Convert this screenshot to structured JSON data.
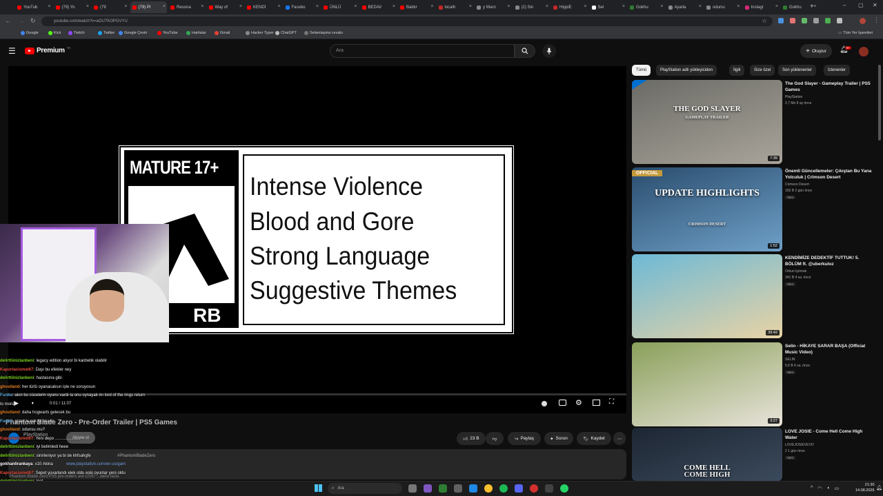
{
  "browser": {
    "tabs": [
      {
        "label": "YouTub",
        "color": "#ff0000"
      },
      {
        "label": "(79) Yo",
        "color": "#ff0000"
      },
      {
        "label": "(79",
        "color": "#ff0000"
      },
      {
        "label": "(79) Pl",
        "color": "#ff0000"
      },
      {
        "label": "Resona",
        "color": "#ff0000"
      },
      {
        "label": "Way of",
        "color": "#ff0000"
      },
      {
        "label": "KENDİ",
        "color": "#ff0000"
      },
      {
        "label": "Facebo",
        "color": "#1877f2"
      },
      {
        "label": "ÜNLÜ",
        "color": "#ff0000"
      },
      {
        "label": "BEDAV",
        "color": "#ff0000"
      },
      {
        "label": "Baldır",
        "color": "#ff0000"
      },
      {
        "label": "localh",
        "color": "#c62828"
      },
      {
        "label": "y Warn",
        "color": "#888888"
      },
      {
        "label": "(2) Sin",
        "color": "#888888"
      },
      {
        "label": "HippiE",
        "color": "#c62828"
      },
      {
        "label": "Sel",
        "color": "#ffffff"
      },
      {
        "label": "Gokhu",
        "color": "#2e7d32"
      },
      {
        "label": "Ayarla",
        "color": "#888888"
      },
      {
        "label": "odunsı",
        "color": "#888888"
      },
      {
        "label": "Instagr",
        "color": "#d62976"
      },
      {
        "label": "Gokhu",
        "color": "#2e7d32"
      }
    ],
    "url": "youtube.com/watch?v=aOU7KOPGVYU",
    "bookmarks": [
      "Google",
      "Kick",
      "Twitch",
      "Twitter",
      "Google Çeviri",
      "YouTube",
      "Haritalar",
      "Gmail",
      "Hacker Typer",
      "ChatGPT",
      "Selamlaşma cevabı"
    ],
    "bookmarks_right": "Tüm Yer İşaretleri"
  },
  "youtube": {
    "logo": "Premium",
    "logo_region": "TR",
    "search_placeholder": "Ara",
    "create_label": "Oluştur",
    "notif_count": "9+"
  },
  "video": {
    "rating_title": "MATURE 17+",
    "rating_foot": "RB",
    "descriptors": [
      "Intense Violence",
      "Blood and Gore",
      "Strong Language",
      "Suggestive Themes"
    ],
    "time": "0:01 / 11:07",
    "title": "Phantom Blade Zero - Pre-Order Trailer | PS5 Games",
    "channel": "PlayStation",
    "subscribe": "Abone ol",
    "desc_link": "www.playstation.com/en-us/gam",
    "desc_tag": "#PhantomBladeZero",
    "desc_line": "Phantom Blade Zero PS5 pre-orders are LIVE!  ...daha fazla"
  },
  "actions": {
    "likes": "23 B",
    "share": "Paylaş",
    "ask": "Sorun",
    "save": "Kaydet"
  },
  "chat": [
    {
      "user": "delirttiinizlanbeni",
      "color": "#7ed321",
      "msg": ": legacy edition alıyor bi kanbetik olabilir"
    },
    {
      "user": "Kaportacismet67",
      "color": "#e74c3c",
      "msg": ": Dayı bu efekler ney"
    },
    {
      "user": "delirttiinizlanbeni",
      "color": "#7ed321",
      "msg": ": hastasına gibi"
    },
    {
      "user": "ghostland",
      "color": "#e67e22",
      "msg": ": her türlü oyanacaksın işte ne soruyosun"
    },
    {
      "user": "Funku",
      "color": "#5dade2",
      "msg": ": akın bu cücelerin oyunu vardı la onu oynayak mı lord of the rings return"
    },
    {
      "user": "",
      "color": "#ffffff",
      "msg": "to moria"
    },
    {
      "user": "ghostland",
      "color": "#e67e22",
      "msg": ": daha hogwarts gelecek bu"
    },
    {
      "user": "Funku",
      "color": "#5dade2",
      "msg": ": güzel la çok iyi akıyor"
    },
    {
      "user": "ghostland",
      "color": "#e67e22",
      "msg": ": odunsu mu?"
    },
    {
      "user": "Kaportacismet67",
      "color": "#e74c3c",
      "msg": ": Yeni depo ......................"
    },
    {
      "user": "delirttiinizlanbeni",
      "color": "#7ed321",
      "msg": ": iyi betimledi heee"
    },
    {
      "user": "delirttiinizlanbeni",
      "color": "#7ed321",
      "msg": ": sinirleniyor ya bi de khfsahgfe"
    },
    {
      "user": "gokhanlirankaya",
      "color": "#ffffff",
      "msg": ": x10 Akina"
    },
    {
      "user": "Kaportacismet67",
      "color": "#e74c3c",
      "msg": ": Sepet yuvarlandı elek oldu eski oyunlar yeni oldu"
    },
    {
      "user": "delirttiinizlanbeni",
      "color": "#7ed321",
      "msg": ": loot"
    },
    {
      "user": "Funku",
      "color": "#5dade2",
      "msg": ": loot"
    }
  ],
  "sidebar": {
    "chips": [
      "Tümü",
      "PlayStation adlı yükleyiciden",
      "İlgili",
      "Size özel",
      "Son yüklenenler",
      "İzlenenler"
    ],
    "videos": [
      {
        "title": "The God Slayer - Gameplay Trailer | PS5 Games",
        "channel": "PlayStation",
        "meta": "2,7 Mn  8 ay önce",
        "duration": "7:39",
        "badge": "",
        "overlay": "THE GOD SLAYER",
        "overlay2": "GAMEPLAY TRAILER",
        "bg1": "#6b6b66",
        "bg2": "#a9a49a"
      },
      {
        "title": "Önemli Güncellemeler: Çıkıştan Bu Yana Yolculuk | Crimson Desert",
        "channel": "Crimson Desert",
        "meta": "165 B  2 gün önce",
        "duration": "1:52",
        "badge": "Yeni",
        "overlay": "UPDATE HIGHLIGHTS",
        "overlay2": "CRIMSON DESERT",
        "bg1": "#2a4d6e",
        "bg2": "#6fa0c8"
      },
      {
        "title": "KENDİMİZE DEDEKTİF TUTTUK! 5. BÖLÜM ft. @uberkuloz",
        "channel": "Orkun Işıtmak",
        "meta": "341 B  4 sa. önce",
        "duration": "39:42",
        "badge": "Yeni",
        "overlay": "",
        "overlay2": "",
        "bg1": "#6db9d6",
        "bg2": "#e8d3a5"
      },
      {
        "title": "Selin - HİKAYE SARAR BAŞA (Official Music Video)",
        "channel": "SELIN",
        "meta": "5,6 B  6 sa. önce",
        "duration": "3:27",
        "badge": "Yeni",
        "overlay": "",
        "overlay2": "",
        "bg1": "#8aa05a",
        "bg2": "#e8e3da"
      },
      {
        "title": "LOVE JOSIE - Come Hell Come High Water",
        "channel": "LOVEJOSIEVEVO",
        "meta": "2  1 gün önce",
        "duration": "",
        "badge": "Yeni",
        "overlay": "COME HELL",
        "overlay2": "COME HIGH",
        "bg1": "#1d2633",
        "bg2": "#3b4a5c"
      }
    ]
  },
  "taskbar": {
    "search": "Ara",
    "time": "21:30",
    "date": "14.08.2026"
  }
}
